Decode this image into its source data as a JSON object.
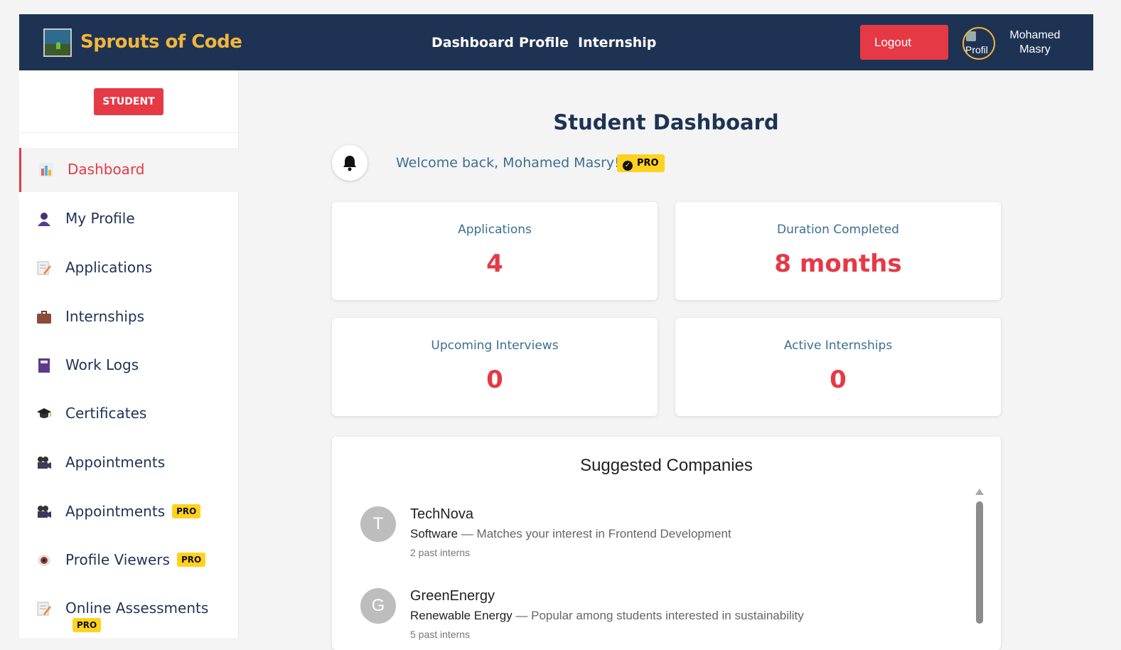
{
  "header": {
    "brand": "Sprouts of Code",
    "nav": [
      "Dashboard",
      "Profile",
      "Internship"
    ],
    "logout_label": "Logout",
    "avatar_alt": "Profil",
    "user_first": "Mohamed",
    "user_last": "Masry"
  },
  "sidebar": {
    "role": "STUDENT",
    "items": [
      {
        "label": "Dashboard",
        "icon": "chart-icon",
        "pro": "",
        "active": true
      },
      {
        "label": "My Profile",
        "icon": "person-icon",
        "pro": ""
      },
      {
        "label": "Applications",
        "icon": "memo-icon",
        "pro": ""
      },
      {
        "label": "Internships",
        "icon": "briefcase-icon",
        "pro": ""
      },
      {
        "label": "Work Logs",
        "icon": "notebook-icon",
        "pro": ""
      },
      {
        "label": "Certificates",
        "icon": "graduation-cap-icon",
        "pro": ""
      },
      {
        "label": "Appointments",
        "icon": "video-camera-icon",
        "pro": ""
      },
      {
        "label": "Appointments",
        "icon": "video-camera-icon",
        "pro": "PRO"
      },
      {
        "label": "Profile Viewers",
        "icon": "eye-icon",
        "pro": "PRO"
      },
      {
        "label": "Online Assessments",
        "icon": "memo-icon",
        "pro": "PRO"
      }
    ]
  },
  "main": {
    "title": "Student Dashboard",
    "welcome": "Welcome back, Mohamed Masry!",
    "pro_badge": "PRO",
    "stats": [
      {
        "label": "Applications",
        "value": "4"
      },
      {
        "label": "Duration Completed",
        "value": "8 months"
      },
      {
        "label": "Upcoming Interviews",
        "value": "0"
      },
      {
        "label": "Active Internships",
        "value": "0"
      }
    ]
  },
  "companies": {
    "title": "Suggested Companies",
    "items": [
      {
        "initial": "T",
        "name": "TechNova",
        "industry": "Software",
        "reason": " — Matches your interest in Frontend Development",
        "interns": "2 past interns"
      },
      {
        "initial": "G",
        "name": "GreenEnergy",
        "industry": "Renewable Energy",
        "reason": " — Popular among students interested in sustainability",
        "interns": "5 past interns"
      }
    ]
  },
  "colors": {
    "header_bg": "#1e3354",
    "brand": "#f3b63a",
    "accent_red": "#e63946",
    "pro_yellow": "#ffd21f",
    "text_blue": "#3c6f8f"
  }
}
